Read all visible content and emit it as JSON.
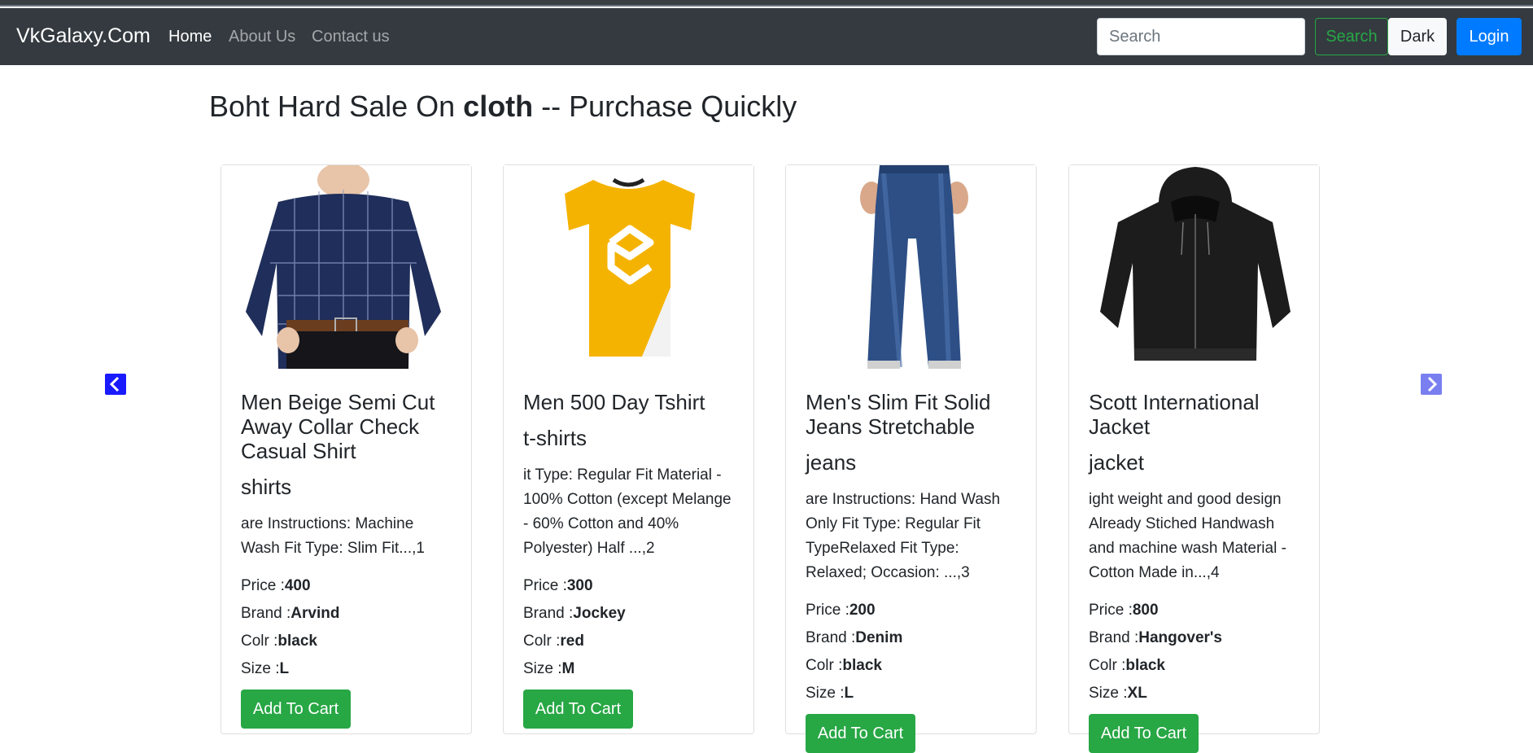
{
  "navbar": {
    "brand": "VkGalaxy.Com",
    "links": [
      "Home",
      "About Us",
      "Contact us"
    ],
    "search_placeholder": "Search",
    "search_button": "Search",
    "theme_button": "Dark",
    "login_button": "Login"
  },
  "heading": {
    "prefix": "Boht Hard Sale On ",
    "category": "cloth",
    "suffix": " -- Purchase Quickly"
  },
  "labels": {
    "price": "Price :",
    "brand": "Brand :",
    "color": "Colr :",
    "size": "Size :",
    "add_to_cart": "Add To Cart"
  },
  "products": [
    {
      "title": "Men Beige Semi Cut Away Collar Check Casual Shirt",
      "category": "shirts",
      "description": "are Instructions: Machine Wash Fit Type: Slim Fit...,1",
      "price": "400",
      "brand": "Arvind",
      "color": "black",
      "size": "L",
      "image": "checked-shirt-photo"
    },
    {
      "title": "Men 500 Day Tshirt",
      "category": "t-shirts",
      "description": "it Type: Regular Fit Material - 100% Cotton (except Melange - 60% Cotton and 40% Polyester) Half ...,2",
      "price": "300",
      "brand": "Jockey",
      "color": "red",
      "size": "M",
      "image": "yellow-tshirt-photo"
    },
    {
      "title": "Men's Slim Fit Solid Jeans Stretchable",
      "category": "jeans",
      "description": "are Instructions: Hand Wash Only Fit Type: Regular Fit TypeRelaxed Fit Type: Relaxed; Occasion: ...,3",
      "price": "200",
      "brand": "Denim",
      "color": "black",
      "size": "L",
      "image": "blue-jeans-photo"
    },
    {
      "title": "Scott International Jacket",
      "category": "jacket",
      "description": "ight weight and good design Already Stiched Handwash and machine wash Material - Cotton Made in...,4",
      "price": "800",
      "brand": "Hangover's",
      "color": "black",
      "size": "XL",
      "image": "black-hoodie-photo"
    }
  ],
  "carousel": {
    "prev_icon": "chevron-left-icon",
    "next_icon": "chevron-right-icon"
  },
  "colors": {
    "navbar": "#343a40",
    "success": "#28a745",
    "primary": "#007bff"
  }
}
